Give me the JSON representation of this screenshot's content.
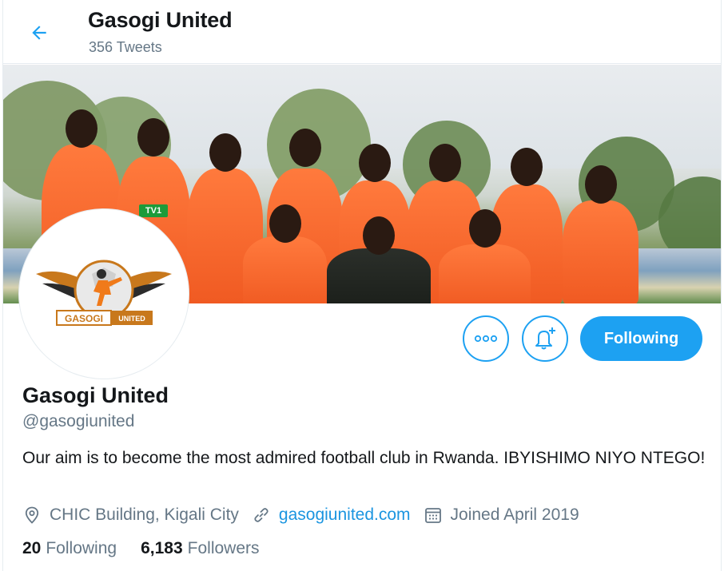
{
  "header": {
    "name": "Gasogi United",
    "tweet_count": "356 Tweets",
    "back_icon": "arrow-left-icon"
  },
  "banner": {
    "kit_sponsor": "TV1"
  },
  "avatar": {
    "logo_text_left": "GASOGI",
    "logo_text_right": "UNITED"
  },
  "actions": {
    "more_icon": "more-dots-icon",
    "notify_icon": "bell-plus-icon",
    "follow_label": "Following"
  },
  "profile": {
    "name": "Gasogi United",
    "handle": "@gasogiunited",
    "bio": "Our aim is to become the most admired football club in Rwanda. IBYISHIMO NIYO NTEGO!",
    "location": "CHIC Building, Kigali City",
    "website": "gasogiunited.com",
    "joined": "Joined April 2019"
  },
  "stats": {
    "following_count": "20",
    "following_label": "Following",
    "followers_count": "6,183",
    "followers_label": "Followers"
  },
  "colors": {
    "accent": "#1da1f2",
    "link": "#1b95e0",
    "muted": "#657786",
    "text": "#14171a",
    "kit_orange": "#f05a22"
  }
}
